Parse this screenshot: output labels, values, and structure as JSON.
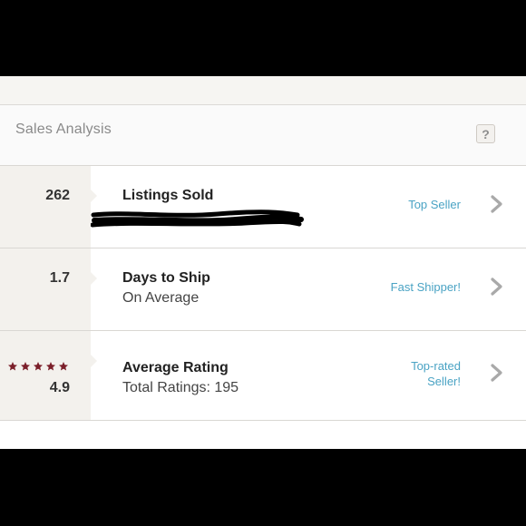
{
  "header": {
    "title": "Sales Analysis",
    "help_label": "?"
  },
  "rows": [
    {
      "metric": "262",
      "title": "Listings Sold",
      "subtitle": "",
      "badge_lines": [
        "Top Seller"
      ]
    },
    {
      "metric": "1.7",
      "title": "Days to Ship",
      "subtitle": "On Average",
      "badge_lines": [
        "Fast Shipper!"
      ]
    },
    {
      "metric": "4.9",
      "title": "Average Rating",
      "subtitle": "Total Ratings: 195",
      "badge_lines": [
        "Top-rated",
        "Seller!"
      ],
      "stars": 5
    }
  ],
  "colors": {
    "accent": "#4aa3c4",
    "star": "#7b1f2a",
    "chevron": "#a9a9a9"
  },
  "icons": {
    "help": "question-icon",
    "chevron": "chevron-right-icon",
    "star": "star-icon"
  }
}
